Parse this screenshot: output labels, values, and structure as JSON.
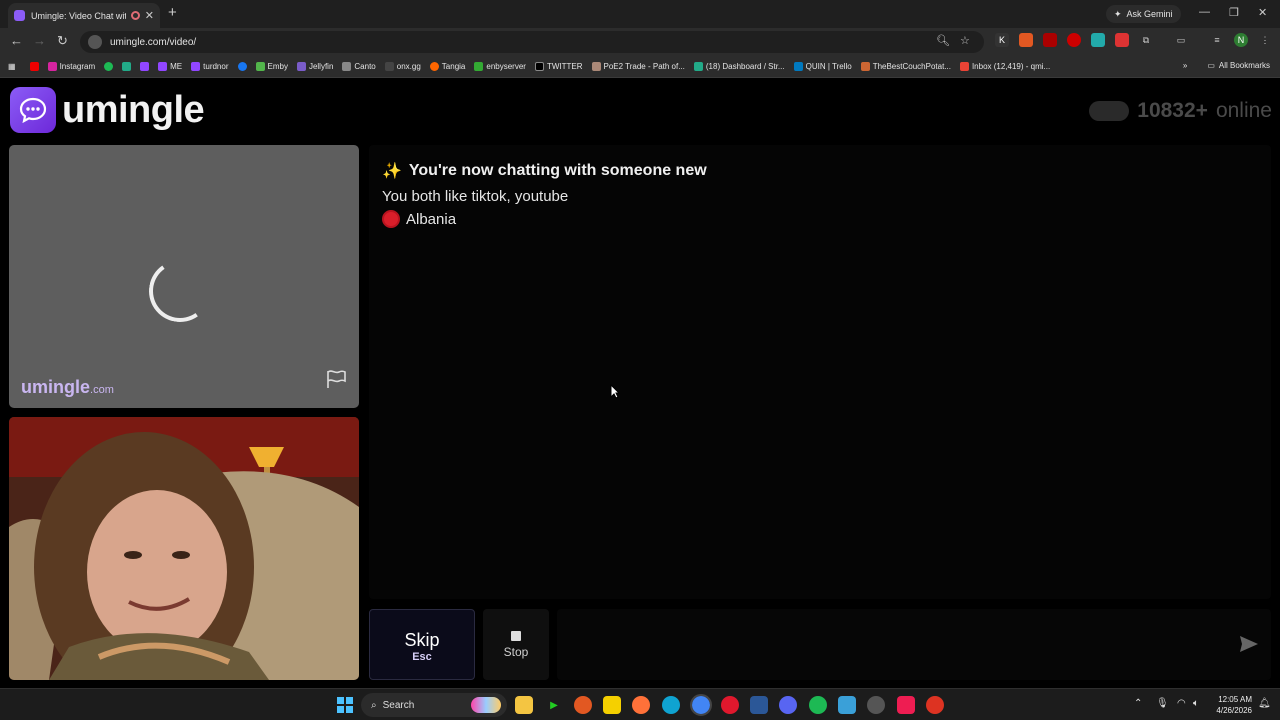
{
  "browser": {
    "tab_title": "Umingle: Video Chat with S",
    "ask_gemini": "Ask Gemini",
    "url": "umingle.com/video/",
    "bookmarks": [
      "Instagram",
      "ME",
      "turdnor",
      "Emby",
      "Jellyfin",
      "Canto",
      "onx.gg",
      "Tangia",
      "enbyserver",
      "TWITTER",
      "PoE2 Trade - Path of...",
      "(18) Dashboard / Str...",
      "QUIN | Trello",
      "TheBestCouchPotat...",
      "Inbox (12,419) - qmi..."
    ],
    "all_bookmarks": "All Bookmarks"
  },
  "header": {
    "logo_text": "umingle",
    "online_count": "10832+",
    "online_suffix": "online"
  },
  "remote_video": {
    "watermark": "umingle",
    "watermark_suffix": ".com"
  },
  "chat": {
    "headline_emoji": "✨",
    "headline": "You're now chatting with someone new",
    "interests": "You both like tiktok, youtube",
    "country": "Albania"
  },
  "controls": {
    "skip_label": "Skip",
    "skip_hint": "Esc",
    "stop_label": "Stop",
    "message_placeholder": ""
  },
  "taskbar": {
    "search": "Search",
    "time": "12:05 AM",
    "date": "4/26/2026"
  },
  "colors": {
    "accent": "#8b5cf6",
    "page_bg": "#000000",
    "remote_bg": "#5e5e5e"
  }
}
